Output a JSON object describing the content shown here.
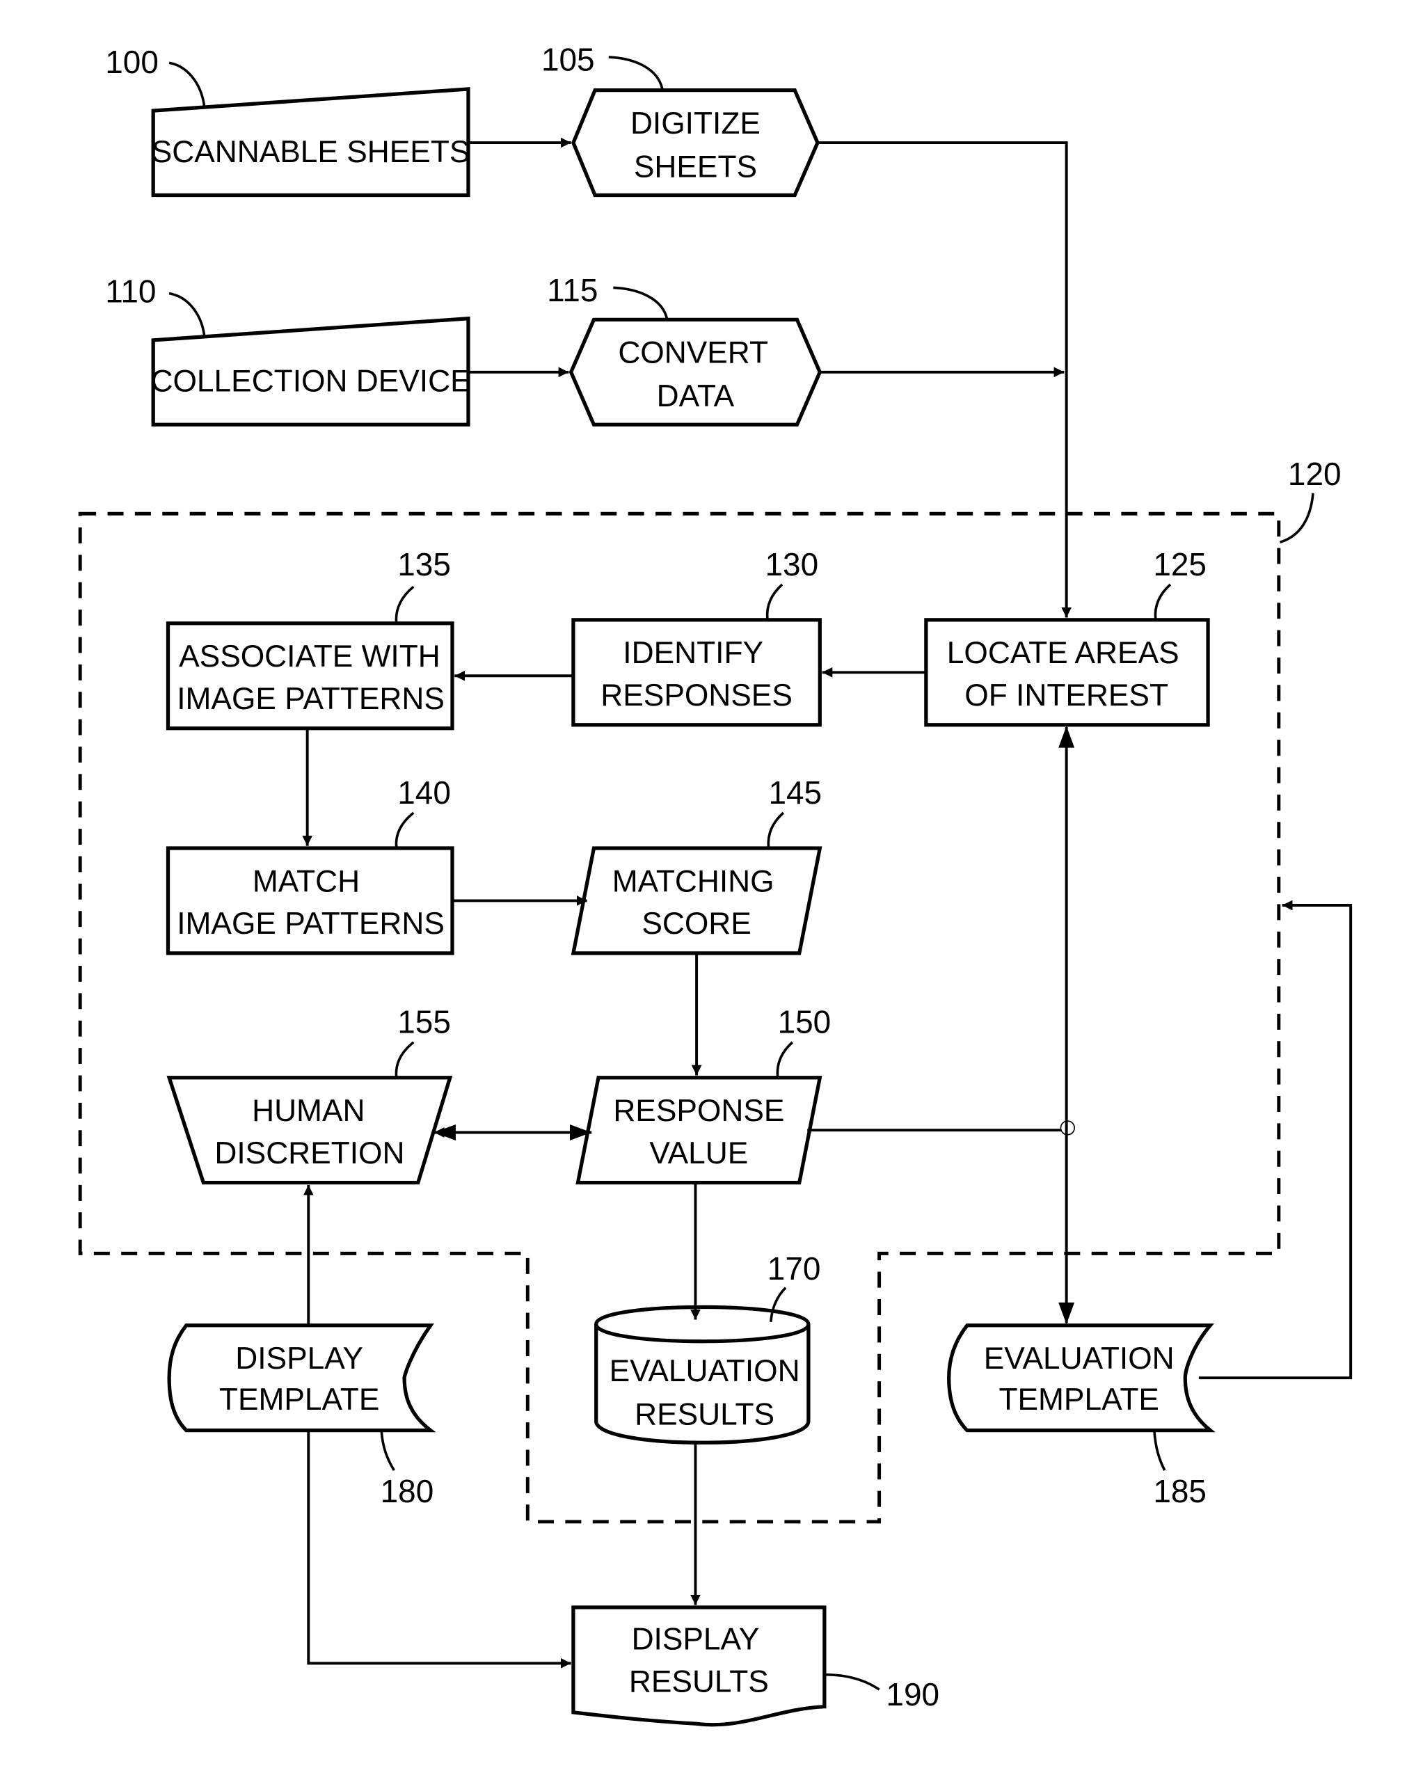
{
  "figure": {
    "group": {
      "ref": "120"
    },
    "nodes": {
      "scannable_sheets": {
        "ref": "100",
        "lines": [
          "SCANNABLE SHEETS"
        ],
        "shape": "manual-input"
      },
      "digitize_sheets": {
        "ref": "105",
        "lines": [
          "DIGITIZE",
          "SHEETS"
        ],
        "shape": "hexagon"
      },
      "collection_device": {
        "ref": "110",
        "lines": [
          "COLLECTION DEVICE"
        ],
        "shape": "manual-input"
      },
      "convert_data": {
        "ref": "115",
        "lines": [
          "CONVERT",
          "DATA"
        ],
        "shape": "hexagon"
      },
      "locate_areas": {
        "ref": "125",
        "lines": [
          "LOCATE AREAS",
          "OF INTEREST"
        ],
        "shape": "rectangle"
      },
      "identify_responses": {
        "ref": "130",
        "lines": [
          "IDENTIFY",
          "RESPONSES"
        ],
        "shape": "rectangle"
      },
      "associate_patterns": {
        "ref": "135",
        "lines": [
          "ASSOCIATE WITH",
          "IMAGE PATTERNS"
        ],
        "shape": "rectangle"
      },
      "match_patterns": {
        "ref": "140",
        "lines": [
          "MATCH",
          "IMAGE PATTERNS"
        ],
        "shape": "rectangle"
      },
      "matching_score": {
        "ref": "145",
        "lines": [
          "MATCHING",
          "SCORE"
        ],
        "shape": "parallelogram"
      },
      "response_value": {
        "ref": "150",
        "lines": [
          "RESPONSE",
          "VALUE"
        ],
        "shape": "parallelogram"
      },
      "human_discretion": {
        "ref": "155",
        "lines": [
          "HUMAN",
          "DISCRETION"
        ],
        "shape": "manual-operation"
      },
      "evaluation_results": {
        "ref": "170",
        "lines": [
          "EVALUATION",
          "RESULTS"
        ],
        "shape": "database"
      },
      "display_template": {
        "ref": "180",
        "lines": [
          "DISPLAY",
          "TEMPLATE"
        ],
        "shape": "stored-data"
      },
      "evaluation_template": {
        "ref": "185",
        "lines": [
          "EVALUATION",
          "TEMPLATE"
        ],
        "shape": "stored-data"
      },
      "display_results": {
        "ref": "190",
        "lines": [
          "DISPLAY",
          "RESULTS"
        ],
        "shape": "document"
      }
    },
    "edges": [
      {
        "from": "scannable_sheets",
        "to": "digitize_sheets"
      },
      {
        "from": "collection_device",
        "to": "convert_data"
      },
      {
        "from": "digitize_sheets",
        "to": "locate_areas"
      },
      {
        "from": "convert_data",
        "to": "locate_areas"
      },
      {
        "from": "locate_areas",
        "to": "identify_responses"
      },
      {
        "from": "identify_responses",
        "to": "associate_patterns"
      },
      {
        "from": "associate_patterns",
        "to": "match_patterns"
      },
      {
        "from": "match_patterns",
        "to": "matching_score"
      },
      {
        "from": "matching_score",
        "to": "response_value"
      },
      {
        "from": "response_value",
        "to": "human_discretion",
        "bidirectional": true
      },
      {
        "from": "display_template",
        "to": "human_discretion"
      },
      {
        "from": "response_value",
        "to": "evaluation_results"
      },
      {
        "from": "locate_areas",
        "to": "evaluation_template",
        "bidirectional": true
      },
      {
        "from": "evaluation_template",
        "to": "group_120"
      },
      {
        "from": "evaluation_results",
        "to": "display_results"
      },
      {
        "from": "display_template",
        "to": "display_results"
      }
    ]
  }
}
